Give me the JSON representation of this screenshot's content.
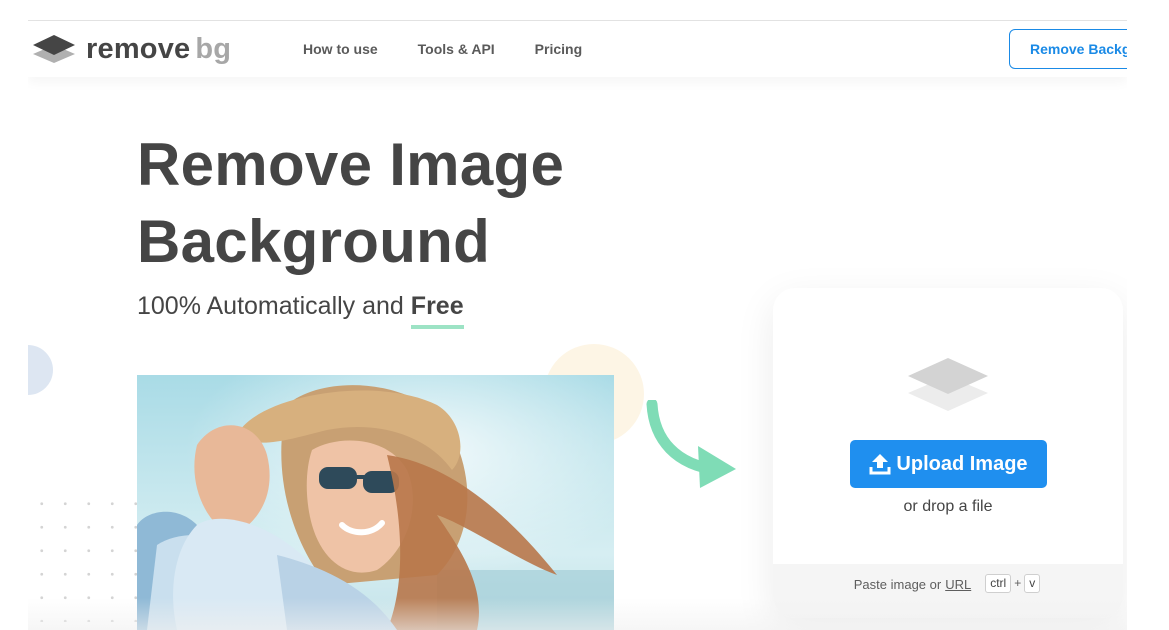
{
  "header": {
    "logo": {
      "text_main": "remove",
      "text_accent": "bg",
      "icon": "layers-icon"
    },
    "nav": [
      {
        "label": "How to use"
      },
      {
        "label": "Tools & API"
      },
      {
        "label": "Pricing"
      }
    ],
    "cta_label": "Remove Background"
  },
  "hero": {
    "title_line1": "Remove Image",
    "title_line2": "Background",
    "subtitle_prefix": "100% Automatically and",
    "subtitle_emphasis": "Free"
  },
  "upload_card": {
    "icon": "layers-icon",
    "button_label": "Upload Image",
    "button_icon": "upload-icon",
    "drop_text": "or drop a file",
    "paste_text": "Paste image or",
    "url_link": "URL",
    "shortcut": [
      "ctrl",
      "+",
      "v"
    ]
  },
  "colors": {
    "accent": "#1f8fef",
    "text": "#454545",
    "highlight": "#9de3c5",
    "arrow": "#7fdcb6"
  }
}
